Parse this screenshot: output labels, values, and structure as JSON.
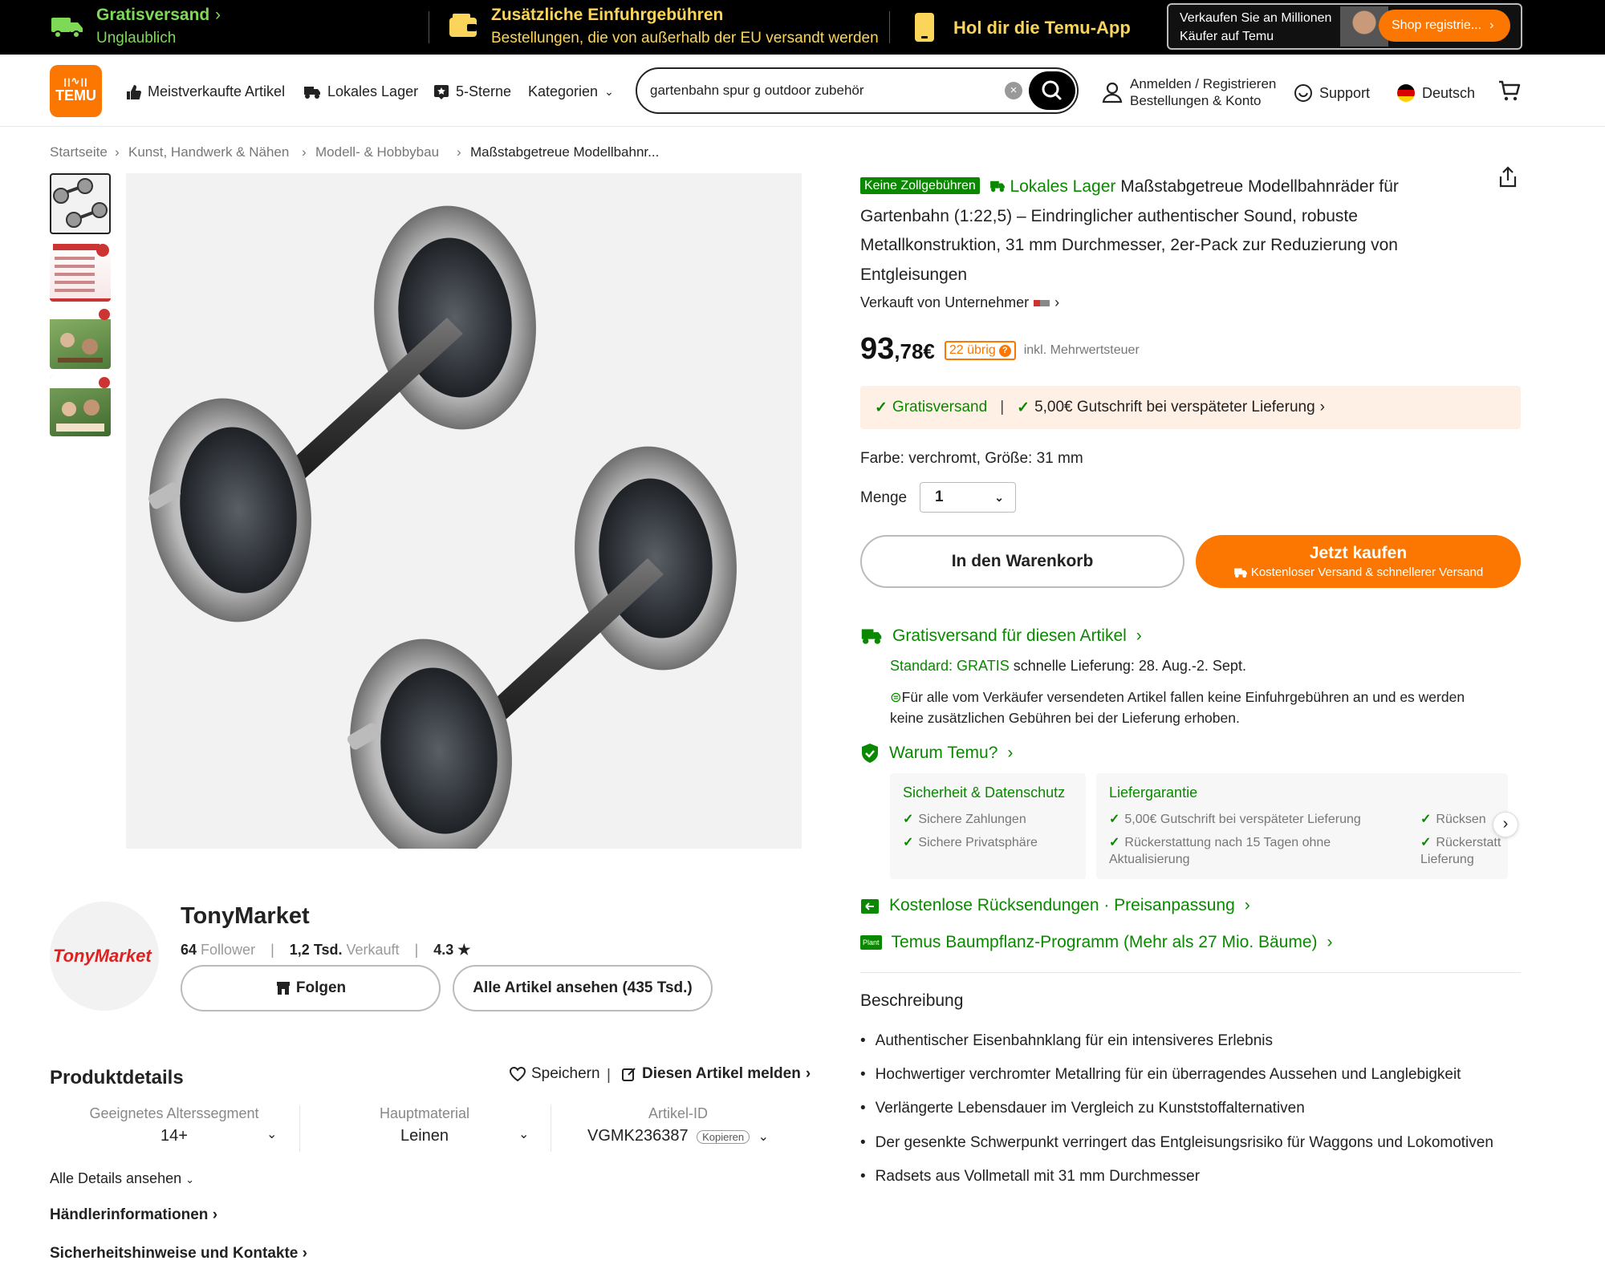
{
  "topbar": {
    "free_shipping_title": "Gratisversand",
    "free_shipping_sub": "Unglaublich",
    "import_fees_title": "Zusätzliche Einfuhrgebühren",
    "import_fees_sub": "Bestellungen, die von außerhalb der EU versandt werden",
    "app_cta": "Hol dir die Temu-App",
    "seller_promo_line1": "Verkaufen Sie an Millionen",
    "seller_promo_line2": "Käufer auf Temu",
    "seller_register_button": "Shop registrie..."
  },
  "nav": {
    "logo_top": "ꞁꞁ∿ꞁꞁ",
    "logo_text": "TEMU",
    "items": [
      "Meistverkaufte Artikel",
      "Lokales Lager",
      "5-Sterne",
      "Kategorien"
    ],
    "search_value": "gartenbahn spur g outdoor zubehör",
    "account_line1": "Anmelden / Registrieren",
    "account_line2": "Bestellungen & Konto",
    "support": "Support",
    "language": "Deutsch"
  },
  "breadcrumb": [
    "Startseite",
    "Kunst, Handwerk & Nähen",
    "Modell- & Hobbybau",
    "Maßstabgetreue Modellbahnr..."
  ],
  "product": {
    "badge_no_customs": "Keine Zollgebühren",
    "badge_local": "Lokales Lager",
    "title": "Maßstabgetreue Modellbahnräder für Gartenbahn (1:22,5) – Eindringlicher authentischer Sound, robuste Metallkonstruktion, 31 mm Durchmesser, 2er-Pack zur Reduzierung von Entgleisungen",
    "sold_by": "Verkauft von Unternehmer",
    "price_main": "93",
    "price_cents": ",78€",
    "stock_badge": "22 übrig",
    "vat_note": "inkl. Mehrwertsteuer",
    "ship_free": "Gratisversand",
    "ship_credit": "5,00€ Gutschrift bei verspäteter Lieferung",
    "variant": "Farbe: verchromt, Größe: 31 mm",
    "qty_label": "Menge",
    "qty_value": "1",
    "add_to_cart": "In den Warenkorb",
    "buy_now": "Jetzt kaufen",
    "buy_now_sub": "Kostenloser Versand & schnellerer Versand"
  },
  "shipping": {
    "title": "Gratisversand für diesen Artikel",
    "standard_label": "Standard: GRATIS",
    "standard_text": "schnelle Lieferung: 28. Aug.-2. Sept.",
    "import_note_1": "Für alle vom Verkäufer versendeten Artikel fallen keine Einfuhrgebühren an und es werden",
    "import_note_2": "keine zusätzlichen Gebühren bei der Lieferung erhoben."
  },
  "why_temu": {
    "title": "Warum Temu?",
    "security_title": "Sicherheit & Datenschutz",
    "security_items": [
      "Sichere Zahlungen",
      "Sichere Privatsphäre"
    ],
    "delivery_title": "Liefergarantie",
    "delivery_item1": "5,00€ Gutschrift bei verspäteter Lieferung",
    "delivery_item2a": "Rückerstattung nach 15 Tagen ohne",
    "delivery_item2b": "Aktualisierung",
    "extra_item1": "Rücksen",
    "extra_item2a": "Rückerstatt",
    "extra_item2b": "Lieferung"
  },
  "returns": "Kostenlose Rücksendungen · Preisanpassung",
  "tree_program": "Temus Baumpflanz-Programm (Mehr als 27 Mio. Bäume)",
  "tree_badge": "Plant",
  "description": {
    "title": "Beschreibung",
    "bullets": [
      "Authentischer Eisenbahnklang für ein intensiveres Erlebnis",
      "Hochwertiger verchromter Metallring für ein überragendes Aussehen und Langlebigkeit",
      "Verlängerte Lebensdauer im Vergleich zu Kunststoffalternativen",
      "Der gesenkte Schwerpunkt verringert das Entgleisungsrisiko für Waggons und Lokomotiven",
      "Radsets aus Vollmetall mit 31 mm Durchmesser"
    ]
  },
  "store": {
    "name": "TonyMarket",
    "logo_text": "TonyMarket",
    "followers_count": "64",
    "followers_label": "Follower",
    "sold_count": "1,2 Tsd.",
    "sold_label": "Verkauft",
    "rating": "4.3 ★",
    "follow_button": "Folgen",
    "all_items_button": "Alle Artikel ansehen (435 Tsd.)"
  },
  "details": {
    "title": "Produktdetails",
    "save": "Speichern",
    "report": "Diesen Artikel melden",
    "attrs": [
      {
        "label": "Geeignetes Alterssegment",
        "value": "14+"
      },
      {
        "label": "Hauptmaterial",
        "value": "Leinen"
      },
      {
        "label": "Artikel-ID",
        "value": "VGMK236387"
      }
    ],
    "copy_label": "Kopieren",
    "all_details": "Alle Details ansehen",
    "seller_info": "Händlerinformationen",
    "safety": "Sicherheitshinweise und Kontakte"
  },
  "colors": {
    "brand_orange": "#fb7701",
    "green": "#0a8800",
    "ship_bg": "#fff0e6"
  }
}
